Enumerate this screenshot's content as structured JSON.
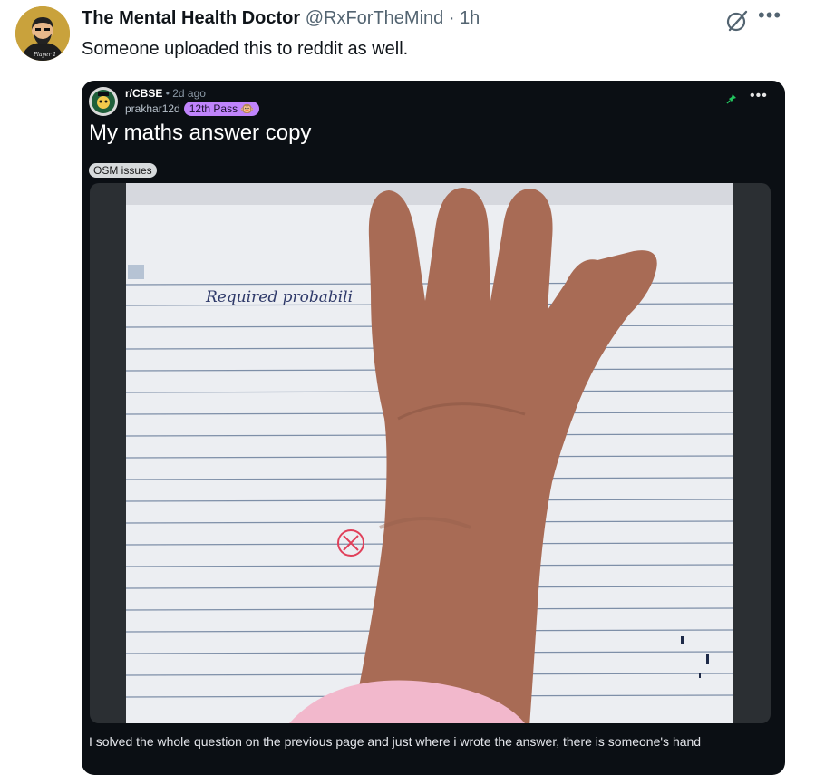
{
  "tweet": {
    "display_name": "The Mental Health Doctor",
    "handle": "@RxForTheMind",
    "separator": "·",
    "time": "1h",
    "text": "Someone uploaded this to reddit as well.",
    "avatar_caption": "Player 1",
    "more_icon": "more-horizontal-icon",
    "grok_icon": "grok-icon"
  },
  "reddit_post": {
    "subreddit": "r/CBSE",
    "time_ago": "• 2d ago",
    "username": "prakhar12d",
    "user_flair": "12th Pass 🐵",
    "title": "My maths answer copy",
    "post_flair": "OSM issues",
    "more_label": "•••",
    "image": {
      "handwritten_text": "Required probabili",
      "description_icon": "notebook-page-with-hand"
    },
    "caption": "I solved the whole question on the previous page and just where i wrote the answer, there is someone's hand"
  },
  "colors": {
    "card_bg": "#0b0f14",
    "flair_purple": "#c084fc",
    "pin_green": "#22c55e",
    "x_mark_red": "#e0405a"
  }
}
